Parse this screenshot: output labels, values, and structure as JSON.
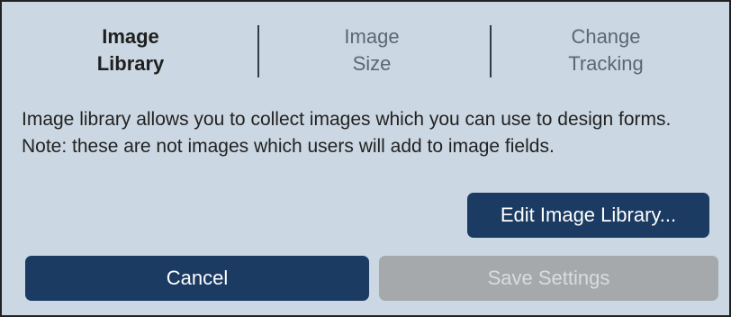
{
  "tabs": [
    {
      "line1": "Image",
      "line2": "Library",
      "active": true
    },
    {
      "line1": "Image",
      "line2": "Size",
      "active": false
    },
    {
      "line1": "Change",
      "line2": "Tracking",
      "active": false
    }
  ],
  "description": "Image library allows you to collect images which you can use to design forms. Note: these are not images which users will add to image fields.",
  "buttons": {
    "edit_library": "Edit Image Library...",
    "cancel": "Cancel",
    "save": "Save Settings"
  },
  "colors": {
    "panel_background": "#cbd7e2",
    "primary_button": "#1b3b63",
    "disabled_button": "#a6a9ac",
    "disabled_text": "#d9dcdf"
  }
}
